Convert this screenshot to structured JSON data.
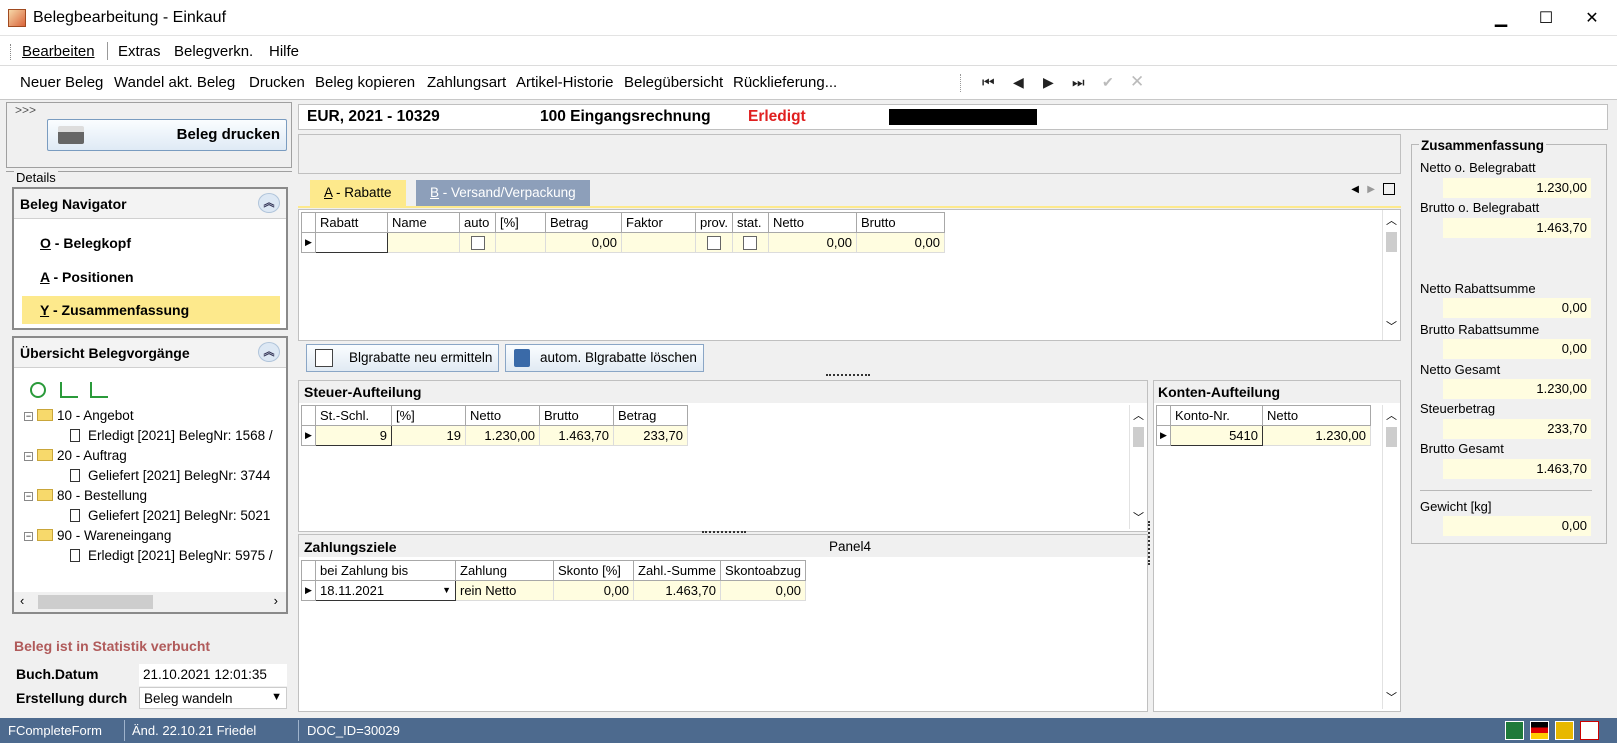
{
  "window": {
    "title": "Belegbearbeitung - Einkauf",
    "minimize": "▁",
    "maximize": "☐",
    "close": "✕"
  },
  "menu": [
    "Bearbeiten",
    "Extras",
    "Belegverkn.",
    "Hilfe"
  ],
  "toolbar": {
    "buttons": [
      "Neuer Beleg",
      "Wandel akt. Beleg",
      "Drucken",
      "Beleg kopieren",
      "Zahlungsart",
      "Artikel-Historie",
      "Belegübersicht",
      "Rücklieferung..."
    ],
    "nav": [
      "⏮",
      "◀",
      "▶",
      "⏭",
      "✔",
      "✕"
    ]
  },
  "left": {
    "expander": ">>>",
    "print_button": "Beleg drucken",
    "details_label": "Details",
    "navigator_title": "Beleg Navigator",
    "nav_items": [
      {
        "key": "O",
        "label": " - Belegkopf"
      },
      {
        "key": "A",
        "label": " - Positionen"
      },
      {
        "key": "Y",
        "label": " - Zusammenfassung"
      }
    ],
    "overview_title": "Übersicht Belegvorgänge",
    "tree": [
      {
        "folder": "10 - Angebot",
        "child": "Erledigt [2021] BelegNr: 1568 /"
      },
      {
        "folder": "20 - Auftrag",
        "child": "Geliefert [2021] BelegNr: 3744"
      },
      {
        "folder": "80 - Bestellung",
        "child": "Geliefert [2021] BelegNr: 5021"
      },
      {
        "folder": "90 - Wareneingang",
        "child": "Erledigt [2021] BelegNr: 5975 /"
      }
    ],
    "statistik_note": "Beleg ist in Statistik verbucht",
    "buch_datum_label": "Buch.Datum",
    "buch_datum_value": "21.10.2021 12:01:35",
    "erstellung_label": "Erstellung durch",
    "erstellung_value": "Beleg wandeln"
  },
  "header": {
    "doc": "EUR, 2021 - 10329",
    "type": "100 Eingangsrechnung",
    "status": "Erledigt"
  },
  "tabs": [
    {
      "key": "A",
      "label": " - Rabatte"
    },
    {
      "key": "B",
      "label": " - Versand/Verpackung"
    }
  ],
  "rabatte": {
    "columns": [
      "Rabatt",
      "Name",
      "auto",
      "[%]",
      "Betrag",
      "Faktor",
      "prov.",
      "stat.",
      "Netto",
      "Brutto"
    ],
    "row": {
      "betrag": "0,00",
      "netto": "0,00",
      "brutto": "0,00"
    },
    "btn_neu": "Blgrabatte neu ermitteln",
    "btn_loeschen": "autom. Blgrabatte löschen"
  },
  "steuer": {
    "title": "Steuer-Aufteilung",
    "columns": [
      "St.-Schl.",
      "[%]",
      "Netto",
      "Brutto",
      "Betrag"
    ],
    "row": [
      "9",
      "19",
      "1.230,00",
      "1.463,70",
      "233,70"
    ]
  },
  "konten": {
    "title": "Konten-Aufteilung",
    "columns": [
      "Konto-Nr.",
      "Netto"
    ],
    "row": [
      "5410",
      "1.230,00"
    ]
  },
  "zahlung": {
    "title": "Zahlungsziele",
    "panel_label": "Panel4",
    "columns": [
      "bei Zahlung bis",
      "Zahlung",
      "Skonto [%]",
      "Zahl.-Summe",
      "Skontoabzug"
    ],
    "row": [
      "18.11.2021",
      "rein Netto",
      "0,00",
      "1.463,70",
      "0,00"
    ]
  },
  "summary": {
    "title": "Zusammenfassung",
    "items": [
      {
        "label": "Netto o. Belegrabatt",
        "value": "1.230,00"
      },
      {
        "label": "Brutto o. Belegrabatt",
        "value": "1.463,70"
      },
      {
        "label": "Netto Rabattsumme",
        "value": "0,00"
      },
      {
        "label": "Brutto Rabattsumme",
        "value": "0,00"
      },
      {
        "label": "Netto Gesamt",
        "value": "1.230,00"
      },
      {
        "label": "Steuerbetrag",
        "value": "233,70"
      },
      {
        "label": "Brutto Gesamt",
        "value": "1.463,70"
      },
      {
        "label": "Gewicht [kg]",
        "value": "0,00"
      }
    ]
  },
  "status": {
    "form": "FCompleteForm",
    "changed": "Änd. 22.10.21 Friedel",
    "doc_id": "DOC_ID=30029"
  }
}
